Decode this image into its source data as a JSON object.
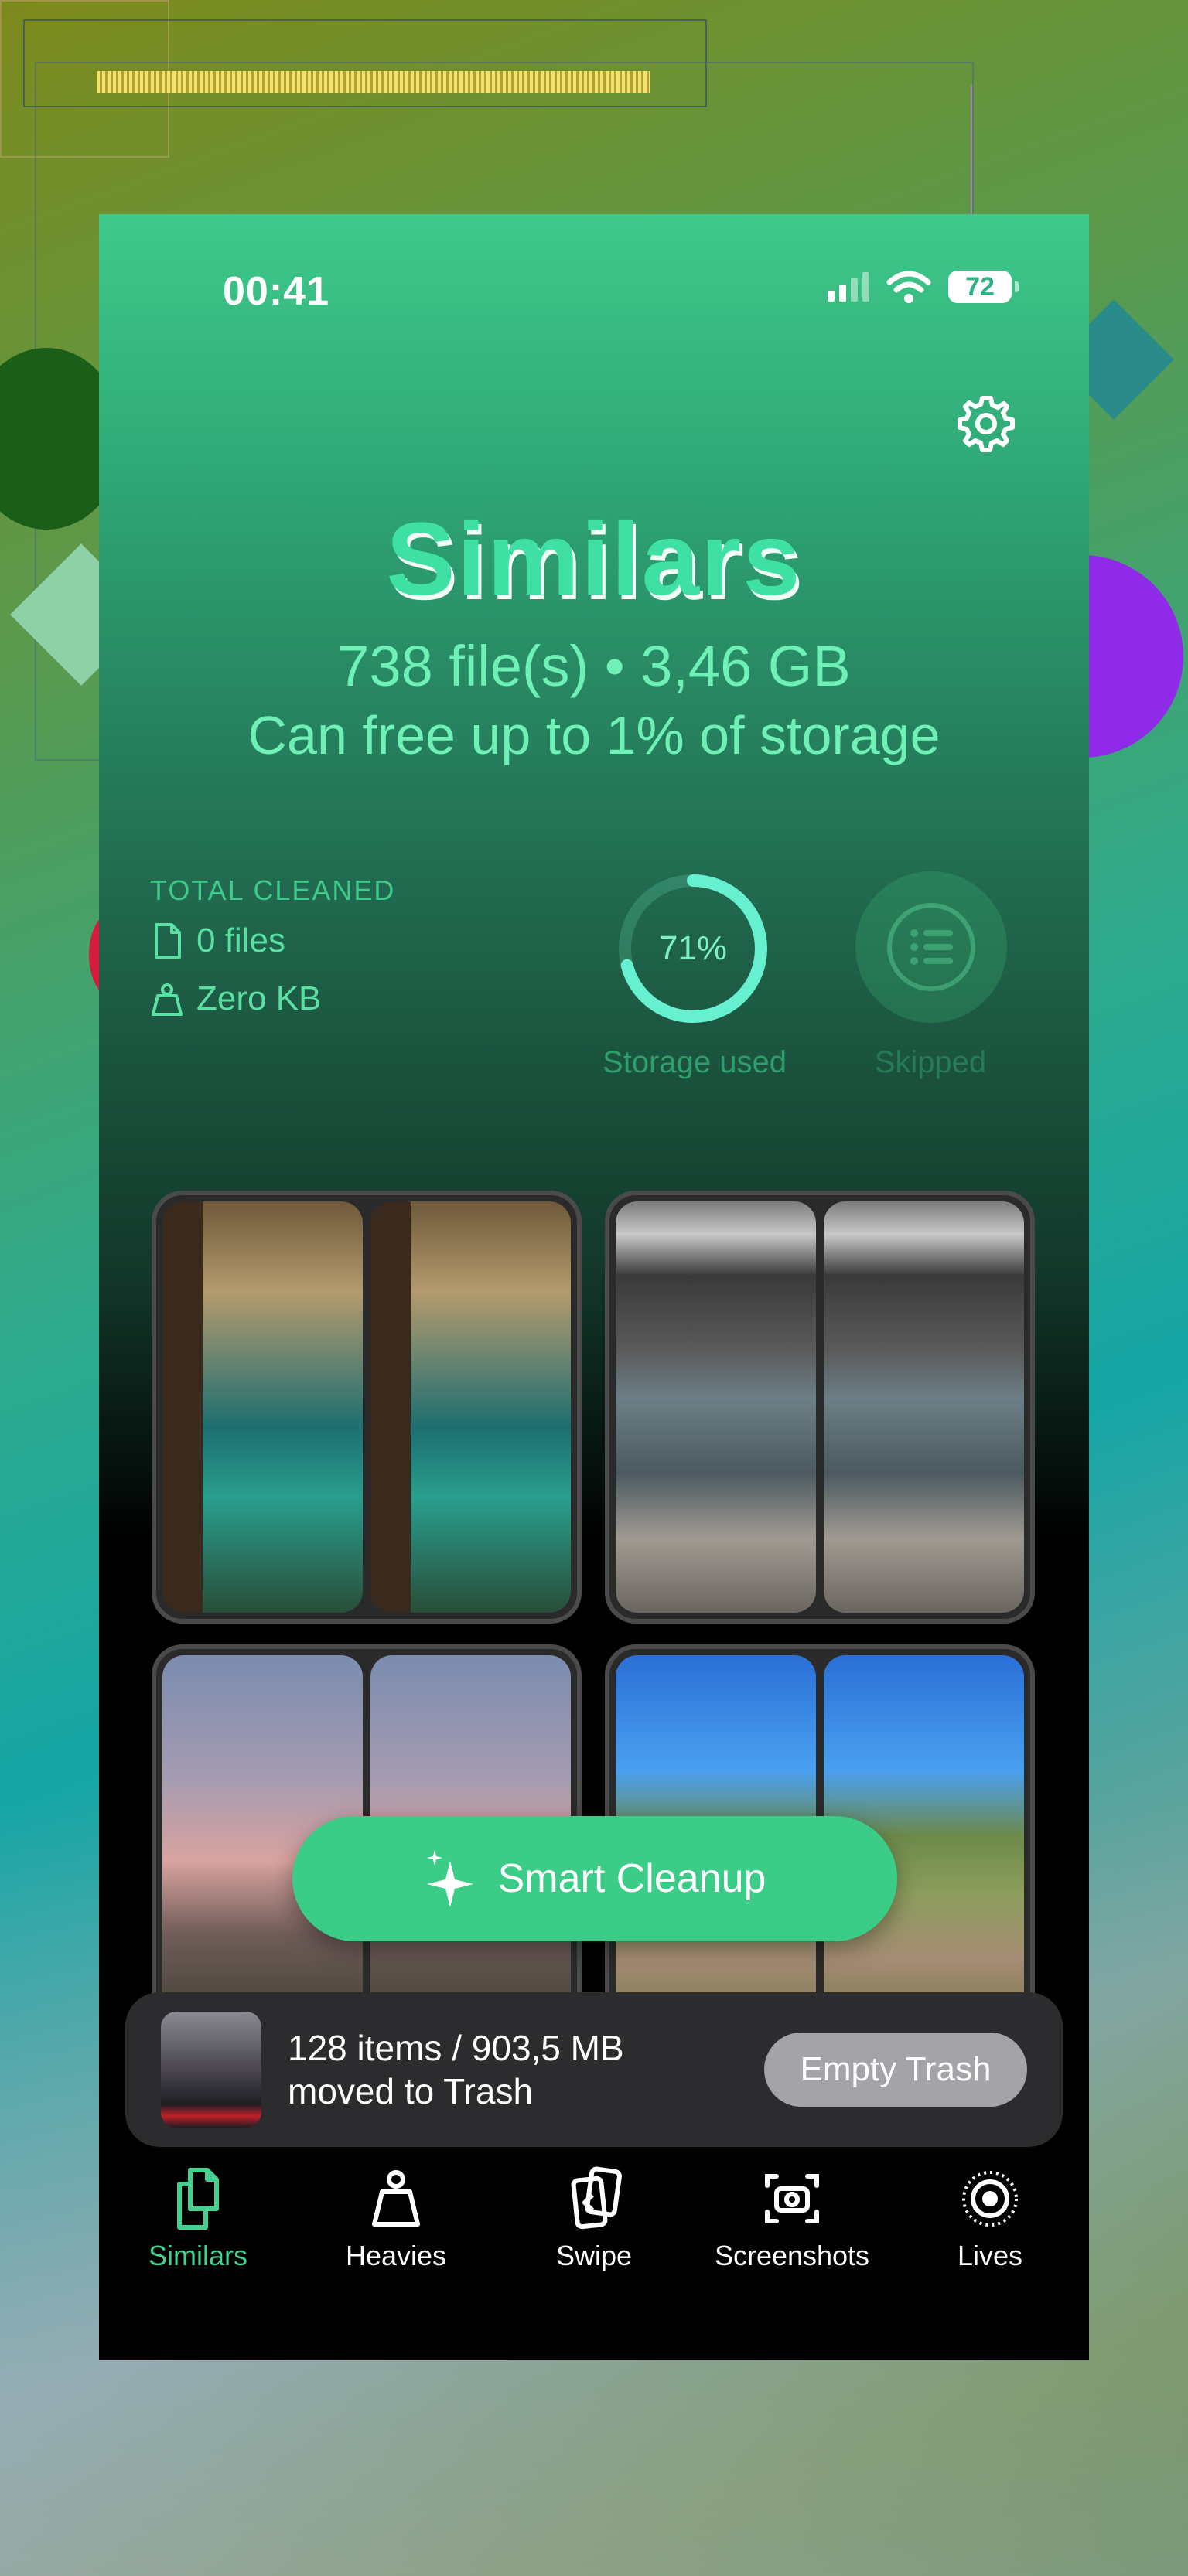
{
  "status": {
    "time": "00:41",
    "battery": "72"
  },
  "header": {
    "title": "Similars",
    "summary": "738 file(s) • 3,46 GB",
    "hint": "Can free up to 1% of storage"
  },
  "stats": {
    "total_cleaned_label": "TOTAL CLEANED",
    "files": "0 files",
    "size": "Zero KB",
    "storage_percent_text": "71%",
    "storage_used_fraction": 0.71,
    "storage_label": "Storage used",
    "skipped_label": "Skipped"
  },
  "smart_cleanup": {
    "label": "Smart Cleanup"
  },
  "trash": {
    "line1": "128 items / 903,5 MB",
    "line2": "moved to Trash",
    "button": "Empty Trash"
  },
  "tabs": [
    {
      "label": "Similars",
      "icon": "copy-icon",
      "active": true
    },
    {
      "label": "Heavies",
      "icon": "weight-icon",
      "active": false
    },
    {
      "label": "Swipe",
      "icon": "swipe-cards-icon",
      "active": false
    },
    {
      "label": "Screenshots",
      "icon": "screenshot-camera-icon",
      "active": false
    },
    {
      "label": "Lives",
      "icon": "live-photo-icon",
      "active": false
    }
  ],
  "colors": {
    "accent": "#3bcc87",
    "active_tab": "#46d08f"
  }
}
